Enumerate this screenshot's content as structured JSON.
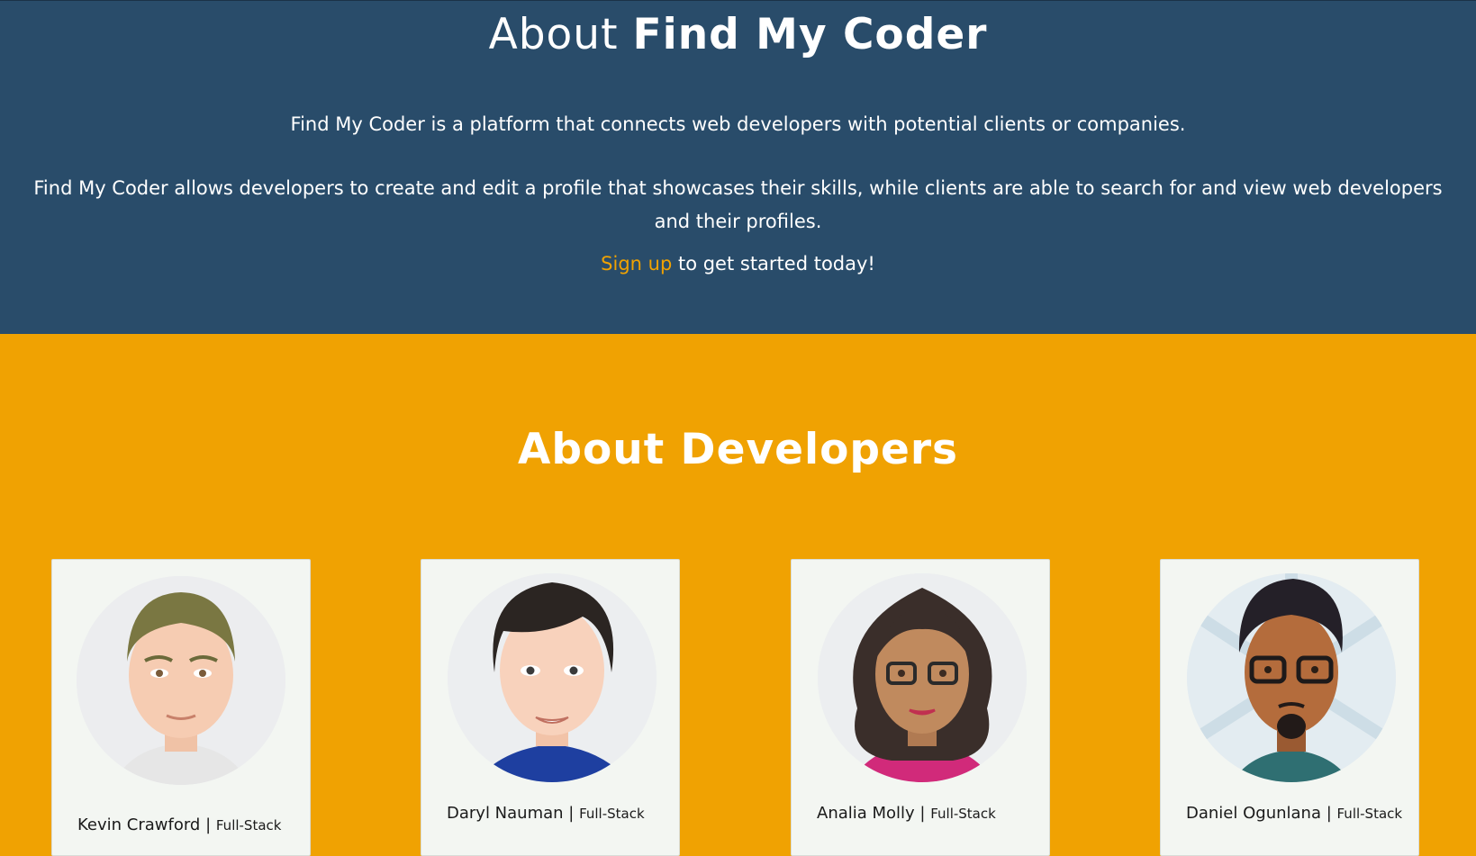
{
  "hero": {
    "title_prefix": "About",
    "title_brand": "Find My Coder",
    "paragraph_1": "Find My Coder is a platform that connects web developers with potential clients or companies.",
    "paragraph_2": "Find My Coder allows developers to create and edit a profile that showcases their skills, while clients are able to search for and view web developers and their profiles.",
    "signup_link": "Sign up",
    "signup_suffix": " to get started today!"
  },
  "developers": {
    "heading": "About Developers",
    "separator": " | ",
    "cards": [
      {
        "name": "Kevin Crawford",
        "role": "Full-Stack",
        "avatar_icon": "male-avatar-icon"
      },
      {
        "name": "Daryl Nauman",
        "role": "Full-Stack",
        "avatar_icon": "male-avatar-icon"
      },
      {
        "name": "Analia Molly",
        "role": "Full-Stack",
        "avatar_icon": "female-avatar-icon"
      },
      {
        "name": "Daniel Ogunlana",
        "role": "Full-Stack",
        "avatar_icon": "male-avatar-icon"
      }
    ]
  },
  "colors": {
    "hero_background": "#294c6a",
    "accent": "#f0a202",
    "card_background": "#f3f6f2"
  }
}
